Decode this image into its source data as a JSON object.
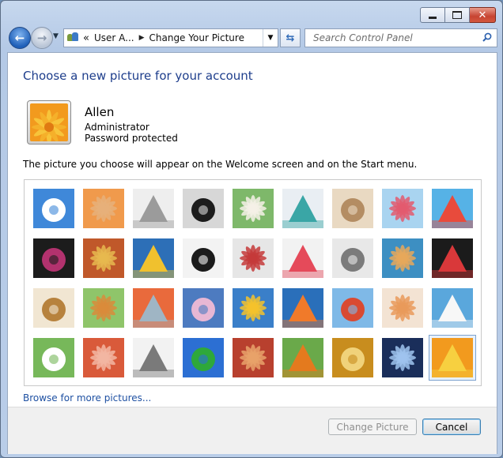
{
  "window": {
    "minimize": "–",
    "close": "✕"
  },
  "nav": {
    "breadcrumb_prefix": "«",
    "crumbs": [
      "User A...",
      "Change Your Picture"
    ],
    "crumb_separator": "▶",
    "dropdown": "▼",
    "search_placeholder": "Search Control Panel"
  },
  "page": {
    "title": "Choose a new picture for your account",
    "user": {
      "name": "Allen",
      "role": "Administrator",
      "status": "Password protected"
    },
    "description": "The picture you choose will appear on the Welcome screen and on the Start menu.",
    "browse_link": "Browse for more pictures...",
    "change_button": "Change Picture",
    "cancel_button": "Cancel"
  },
  "pictures": [
    {
      "name": "roller-coaster",
      "bg": "#3f88d9",
      "fg": "#ffffff"
    },
    {
      "name": "starfish",
      "bg": "#f09a4c",
      "fg": "#e6b07a"
    },
    {
      "name": "robot-figure",
      "bg": "#eeeeee",
      "fg": "#9b9b9b"
    },
    {
      "name": "record-player",
      "bg": "#d7d7d7",
      "fg": "#1c1c1c"
    },
    {
      "name": "lucky-cat",
      "bg": "#7eb86a",
      "fg": "#f4f0e6"
    },
    {
      "name": "spinning-top",
      "bg": "#e9eef3",
      "fg": "#3aa6a6"
    },
    {
      "name": "kitten",
      "bg": "#e9d9c2",
      "fg": "#b48d63"
    },
    {
      "name": "pink-flower",
      "bg": "#a9d4f0",
      "fg": "#e35a6e"
    },
    {
      "name": "pinwheel",
      "bg": "#56b2e6",
      "fg": "#e84b3c"
    },
    {
      "name": "striped-ball",
      "bg": "#1c1c1c",
      "fg": "#b2326e"
    },
    {
      "name": "fabric-stripes",
      "bg": "#c0582a",
      "fg": "#e6b94f"
    },
    {
      "name": "yellow-leaf",
      "bg": "#2d6fb7",
      "fg": "#f0c12e"
    },
    {
      "name": "border-collie",
      "bg": "#f3f3f3",
      "fg": "#1b1b1b"
    },
    {
      "name": "crayons",
      "bg": "#e6e6e6",
      "fg": "#c43a3a"
    },
    {
      "name": "star-flower",
      "bg": "#f2f2f2",
      "fg": "#e54a5a"
    },
    {
      "name": "metal-jack",
      "bg": "#e8e8e8",
      "fg": "#7b7b7b"
    },
    {
      "name": "stairs",
      "bg": "#3d8fc2",
      "fg": "#e6a85a"
    },
    {
      "name": "paper-crane",
      "bg": "#1b1b1b",
      "fg": "#d9383a"
    },
    {
      "name": "guitar",
      "bg": "#f1e6d2",
      "fg": "#b7823d"
    },
    {
      "name": "pomeranian",
      "bg": "#8fc56a",
      "fg": "#d98b3b"
    },
    {
      "name": "toy-robot",
      "bg": "#e96a3c",
      "fg": "#9fb5c4"
    },
    {
      "name": "silk-scarf",
      "bg": "#4d7bc0",
      "fg": "#e8b7d4"
    },
    {
      "name": "sunflower",
      "bg": "#3a7fc9",
      "fg": "#f4c22b"
    },
    {
      "name": "clownfish",
      "bg": "#2a6fba",
      "fg": "#f07a2a"
    },
    {
      "name": "hot-air-balloon",
      "bg": "#7fb9e7",
      "fg": "#d94a32"
    },
    {
      "name": "chick-toy",
      "bg": "#f3e3d3",
      "fg": "#e99a5a"
    },
    {
      "name": "sailboat",
      "bg": "#5aa7dc",
      "fg": "#f7f7f7"
    },
    {
      "name": "soccer-ball",
      "bg": "#77b85a",
      "fg": "#ffffff"
    },
    {
      "name": "woven-fabric",
      "bg": "#d95a3a",
      "fg": "#f2b6a2"
    },
    {
      "name": "marbles",
      "bg": "#f2f2f2",
      "fg": "#7a7a7a"
    },
    {
      "name": "green-window",
      "bg": "#2c6fd3",
      "fg": "#2ea83a"
    },
    {
      "name": "red-textile",
      "bg": "#b8402e",
      "fg": "#e8a26a"
    },
    {
      "name": "butterfly",
      "bg": "#6aa94a",
      "fg": "#e47a1e"
    },
    {
      "name": "shell-spiral",
      "bg": "#c88d1e",
      "fg": "#f0d27a"
    },
    {
      "name": "lighthouse",
      "bg": "#1a2e5a",
      "fg": "#9fc3ef"
    },
    {
      "name": "orange-daisy",
      "bg": "#f29a1e",
      "fg": "#f7d040"
    }
  ],
  "selected_picture": "orange-daisy"
}
